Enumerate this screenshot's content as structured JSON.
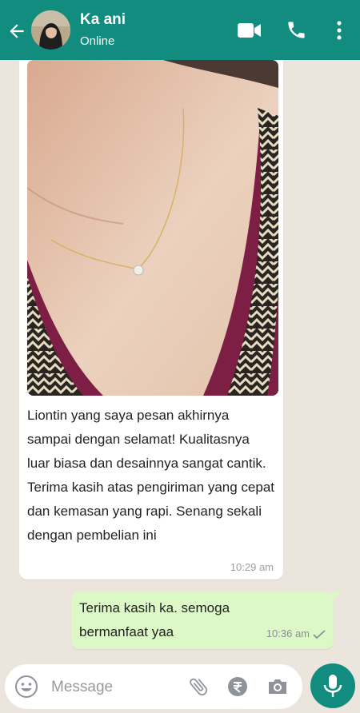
{
  "header": {
    "contact_name": "Ka ani",
    "status": "Online"
  },
  "messages": [
    {
      "direction": "incoming",
      "text": " Liontin yang saya pesan akhirnya sampai dengan selamat! Kualitasnya luar biasa dan desainnya sangat cantik. Terima kasih atas pengiriman yang cepat dan kemasan yang rapi. Senang sekali dengan pembelian ini",
      "time": "10:29 am"
    },
    {
      "direction": "outgoing",
      "text": "Terima kasih ka. semoga bermanfaat yaa",
      "time": "10:36 am"
    }
  ],
  "composer": {
    "placeholder": "Message"
  },
  "colors": {
    "header": "#128c7e",
    "chat_background": "#ece5dd",
    "incoming_bubble": "#ffffff",
    "outgoing_bubble": "#dcf8c6"
  },
  "icons": {
    "back": "arrow-left-icon",
    "video": "video-call-icon",
    "call": "phone-icon",
    "menu": "more-vert-icon",
    "emoji": "emoji-icon",
    "attach": "paperclip-icon",
    "payment": "rupee-icon",
    "camera": "camera-icon",
    "mic": "microphone-icon"
  }
}
